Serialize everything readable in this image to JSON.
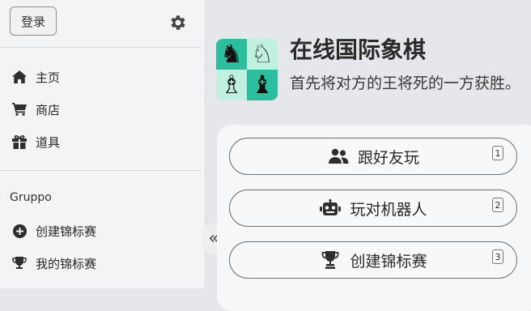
{
  "sidebar": {
    "login_label": "登录",
    "items": [
      {
        "label": "主页",
        "icon": "home-icon"
      },
      {
        "label": "商店",
        "icon": "cart-icon"
      },
      {
        "label": "道具",
        "icon": "gift-icon"
      }
    ],
    "section_title": "Gruppo",
    "section_items": [
      {
        "label": "创建锦标赛",
        "icon": "plus-circle-icon"
      },
      {
        "label": "我的锦标赛",
        "icon": "trophy-icon"
      }
    ],
    "collapse_glyph": "«"
  },
  "hero": {
    "title": "在线国际象棋",
    "subtitle": "首先将对方的王将死的一方获胜。",
    "logo_pieces": [
      "♞",
      "♘",
      "♗",
      "♝"
    ]
  },
  "play_options": [
    {
      "label": "跟好友玩",
      "shortcut": "1",
      "icon": "users-icon"
    },
    {
      "label": "玩对机器人",
      "shortcut": "2",
      "icon": "robot-icon"
    },
    {
      "label": "创建锦标赛",
      "shortcut": "3",
      "icon": "trophy-icon"
    }
  ],
  "colors": {
    "accent": "#2bbf9d",
    "accent_light": "#bff0e0",
    "sidebar_bg": "#f3f4f6",
    "main_bg": "#e5e7ea"
  }
}
